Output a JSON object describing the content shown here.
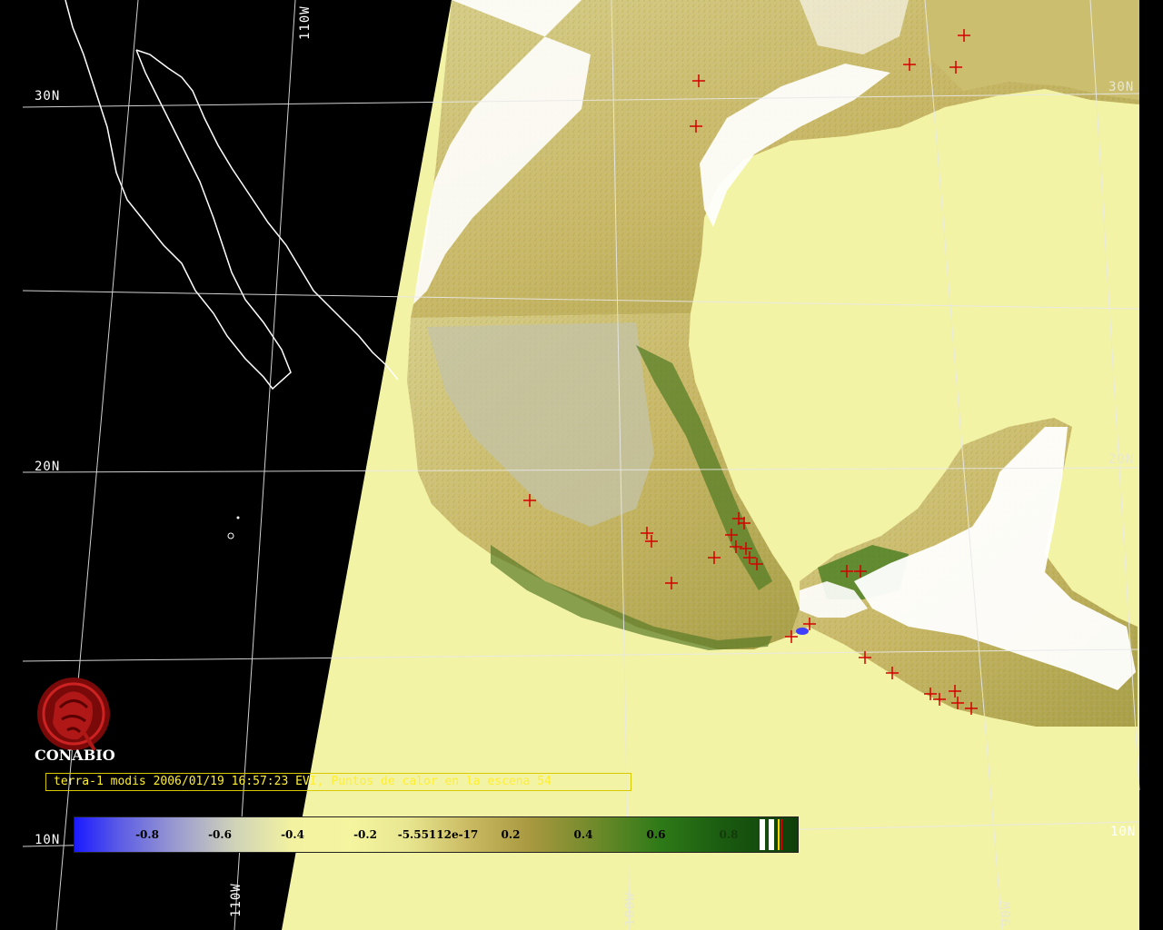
{
  "caption": "terra-1 modis 2006/01/19 16:57:23 EVI, Puntos de calor en la escena 54",
  "logo": {
    "name": "CONABIO"
  },
  "graticule_labels": {
    "lat_30n_left": "30N",
    "lat_20n_left": "20N",
    "lat_10n_left": "10N",
    "lat_30n_right": "30N",
    "lat_20n_right": "20N",
    "lat_10n_right": "10N",
    "lon_110w_top": "110W",
    "lon_110w_bottom": "110W",
    "lon_100w_bottom": "100W",
    "lon_90w_bottom": "90W"
  },
  "colorbar": {
    "ticks": [
      "-0.8",
      "-0.6",
      "-0.4",
      "-0.2",
      "-5.55112e-17",
      "0.2",
      "0.4",
      "0.6",
      "0.8"
    ]
  },
  "colors": {
    "ocean_scene": "#f3f3a6",
    "land_low": "#c8b46a",
    "land_high": "#2e7a18",
    "clouds": "#ffffff",
    "coast_outline": "#ffffff",
    "hotspot": "#d40000",
    "caption_text": "#ffee33"
  }
}
